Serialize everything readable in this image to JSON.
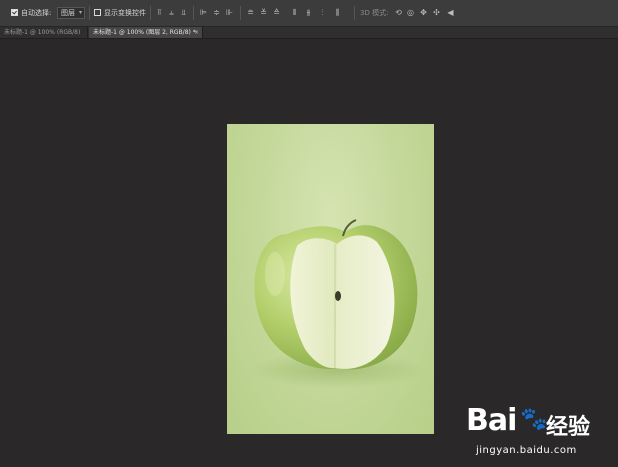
{
  "options_bar": {
    "auto_select_label": "自动选择:",
    "auto_select_checked": true,
    "auto_select_target": "图层",
    "show_transform_label": "显示变换控件",
    "show_transform_checked": false,
    "align_icons": [
      "align-top-edges-icon",
      "align-vertical-centers-icon",
      "align-bottom-edges-icon",
      "align-left-edges-icon",
      "align-horizontal-centers-icon",
      "align-right-edges-icon"
    ],
    "distribute_icons": [
      "distribute-top-icon",
      "distribute-vcenter-icon",
      "distribute-bottom-icon",
      "distribute-left-icon",
      "distribute-hcenter-icon",
      "distribute-right-icon"
    ],
    "mode_3d_label": "3D 模式:"
  },
  "tabs": [
    {
      "label": "未标题-1 @ 100% (RGB/8)",
      "active": false
    },
    {
      "label": "未标题-1 @ 100% (图层 2, RGB/8) *",
      "active": true
    }
  ],
  "watermark": {
    "logo": "Bai",
    "logo_suffix": "经验",
    "url": "jingyan.baidu.com"
  },
  "colors": {
    "app_background": "#2a2829",
    "options_bar": "#3c3c3c",
    "active_tab": "#454545",
    "apple_green": "#a9c761"
  }
}
